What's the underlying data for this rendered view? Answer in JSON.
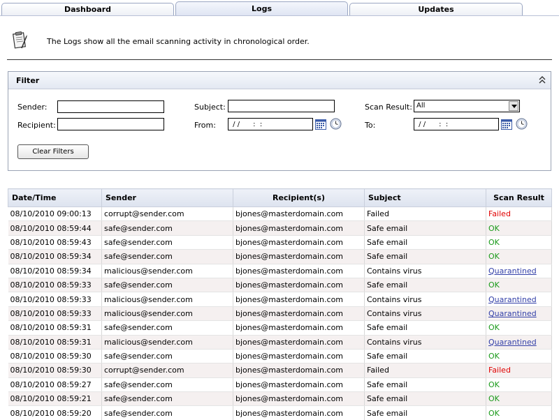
{
  "tabs": [
    {
      "label": "Dashboard"
    },
    {
      "label": "Logs"
    },
    {
      "label": "Updates"
    }
  ],
  "intro": {
    "icon": "clipboard-icon",
    "text": "The Logs show all the email scanning activity in chronological order."
  },
  "filter": {
    "title": "Filter",
    "sender_label": "Sender:",
    "sender_value": "",
    "recipient_label": "Recipient:",
    "recipient_value": "",
    "subject_label": "Subject:",
    "subject_value": "",
    "from_label": "From:",
    "from_value": " / /      :  :",
    "to_label": "To:",
    "to_value": " / /      :  :",
    "scan_result_label": "Scan Result:",
    "scan_result_value": "All",
    "clear_button": "Clear Filters"
  },
  "table": {
    "headers": [
      "Date/Time",
      "Sender",
      "Recipient(s)",
      "Subject",
      "Scan Result"
    ],
    "rows": [
      {
        "datetime": "08/10/2010 09:00:13",
        "sender": "corrupt@sender.com",
        "recipient": "bjones@masterdomain.com",
        "subject": "Failed",
        "result": "Failed"
      },
      {
        "datetime": "08/10/2010 08:59:44",
        "sender": "safe@sender.com",
        "recipient": "bjones@masterdomain.com",
        "subject": "Safe email",
        "result": "OK"
      },
      {
        "datetime": "08/10/2010 08:59:43",
        "sender": "safe@sender.com",
        "recipient": "bjones@masterdomain.com",
        "subject": "Safe email",
        "result": "OK"
      },
      {
        "datetime": "08/10/2010 08:59:34",
        "sender": "safe@sender.com",
        "recipient": "bjones@masterdomain.com",
        "subject": "Safe email",
        "result": "OK"
      },
      {
        "datetime": "08/10/2010 08:59:34",
        "sender": "malicious@sender.com",
        "recipient": "bjones@masterdomain.com",
        "subject": "Contains virus",
        "result": "Quarantined"
      },
      {
        "datetime": "08/10/2010 08:59:33",
        "sender": "safe@sender.com",
        "recipient": "bjones@masterdomain.com",
        "subject": "Safe email",
        "result": "OK"
      },
      {
        "datetime": "08/10/2010 08:59:33",
        "sender": "malicious@sender.com",
        "recipient": "bjones@masterdomain.com",
        "subject": "Contains virus",
        "result": "Quarantined"
      },
      {
        "datetime": "08/10/2010 08:59:33",
        "sender": "malicious@sender.com",
        "recipient": "bjones@masterdomain.com",
        "subject": "Contains virus",
        "result": "Quarantined"
      },
      {
        "datetime": "08/10/2010 08:59:31",
        "sender": "safe@sender.com",
        "recipient": "bjones@masterdomain.com",
        "subject": "Safe email",
        "result": "OK"
      },
      {
        "datetime": "08/10/2010 08:59:31",
        "sender": "malicious@sender.com",
        "recipient": "bjones@masterdomain.com",
        "subject": "Contains virus",
        "result": "Quarantined"
      },
      {
        "datetime": "08/10/2010 08:59:30",
        "sender": "safe@sender.com",
        "recipient": "bjones@masterdomain.com",
        "subject": "Safe email",
        "result": "OK"
      },
      {
        "datetime": "08/10/2010 08:59:30",
        "sender": "corrupt@sender.com",
        "recipient": "bjones@masterdomain.com",
        "subject": "Failed",
        "result": "Failed"
      },
      {
        "datetime": "08/10/2010 08:59:27",
        "sender": "safe@sender.com",
        "recipient": "bjones@masterdomain.com",
        "subject": "Safe email",
        "result": "OK"
      },
      {
        "datetime": "08/10/2010 08:59:21",
        "sender": "safe@sender.com",
        "recipient": "bjones@masterdomain.com",
        "subject": "Safe email",
        "result": "OK"
      },
      {
        "datetime": "08/10/2010 08:59:20",
        "sender": "safe@sender.com",
        "recipient": "bjones@masterdomain.com",
        "subject": "Safe email",
        "result": "OK"
      }
    ]
  },
  "colors": {
    "failed": "#e00000",
    "ok": "#1a9a1a",
    "quarantined": "#3340a8"
  }
}
